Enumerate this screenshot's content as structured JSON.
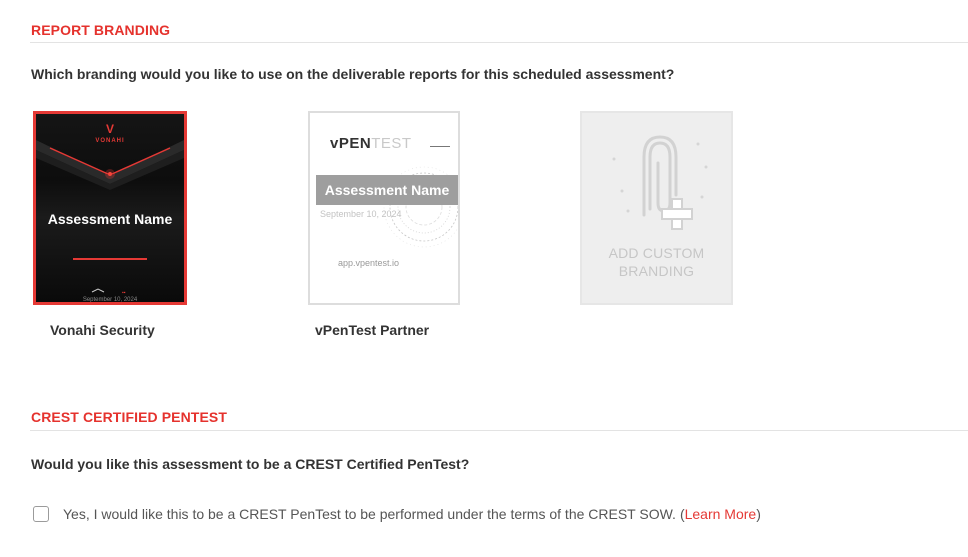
{
  "branding": {
    "title": "REPORT BRANDING",
    "question": "Which branding would you like to use on the deliverable reports for this scheduled assessment?",
    "options": [
      {
        "label": "Vonahi Security",
        "selected": true,
        "preview_logo": "VONAHI",
        "preview_logo_sub": "SECURITY",
        "preview_title": "Assessment Name",
        "preview_date": "September 10, 2024"
      },
      {
        "label": "vPenTest Partner",
        "selected": false,
        "preview_logo_bold": "vPEN",
        "preview_logo_light": "TEST",
        "preview_title": "Assessment Name",
        "preview_date": "September 10, 2024",
        "preview_url": "app.vpentest.io"
      }
    ],
    "add_custom": {
      "line1": "ADD CUSTOM",
      "line2": "BRANDING",
      "icon": "paperclip-plus-icon"
    }
  },
  "crest": {
    "title": "CREST CERTIFIED PENTEST",
    "question": "Would you like this assessment to be a CREST Certified PenTest?",
    "checkbox_label": "Yes, I would like this to be a CREST PenTest to be performed under the terms of the CREST SOW.",
    "checked": false,
    "open_paren": "(",
    "link_text": "Learn More",
    "close_paren": ")"
  },
  "colors": {
    "accent": "#e5322d",
    "selected_border": "#e53935",
    "text": "#333333"
  }
}
